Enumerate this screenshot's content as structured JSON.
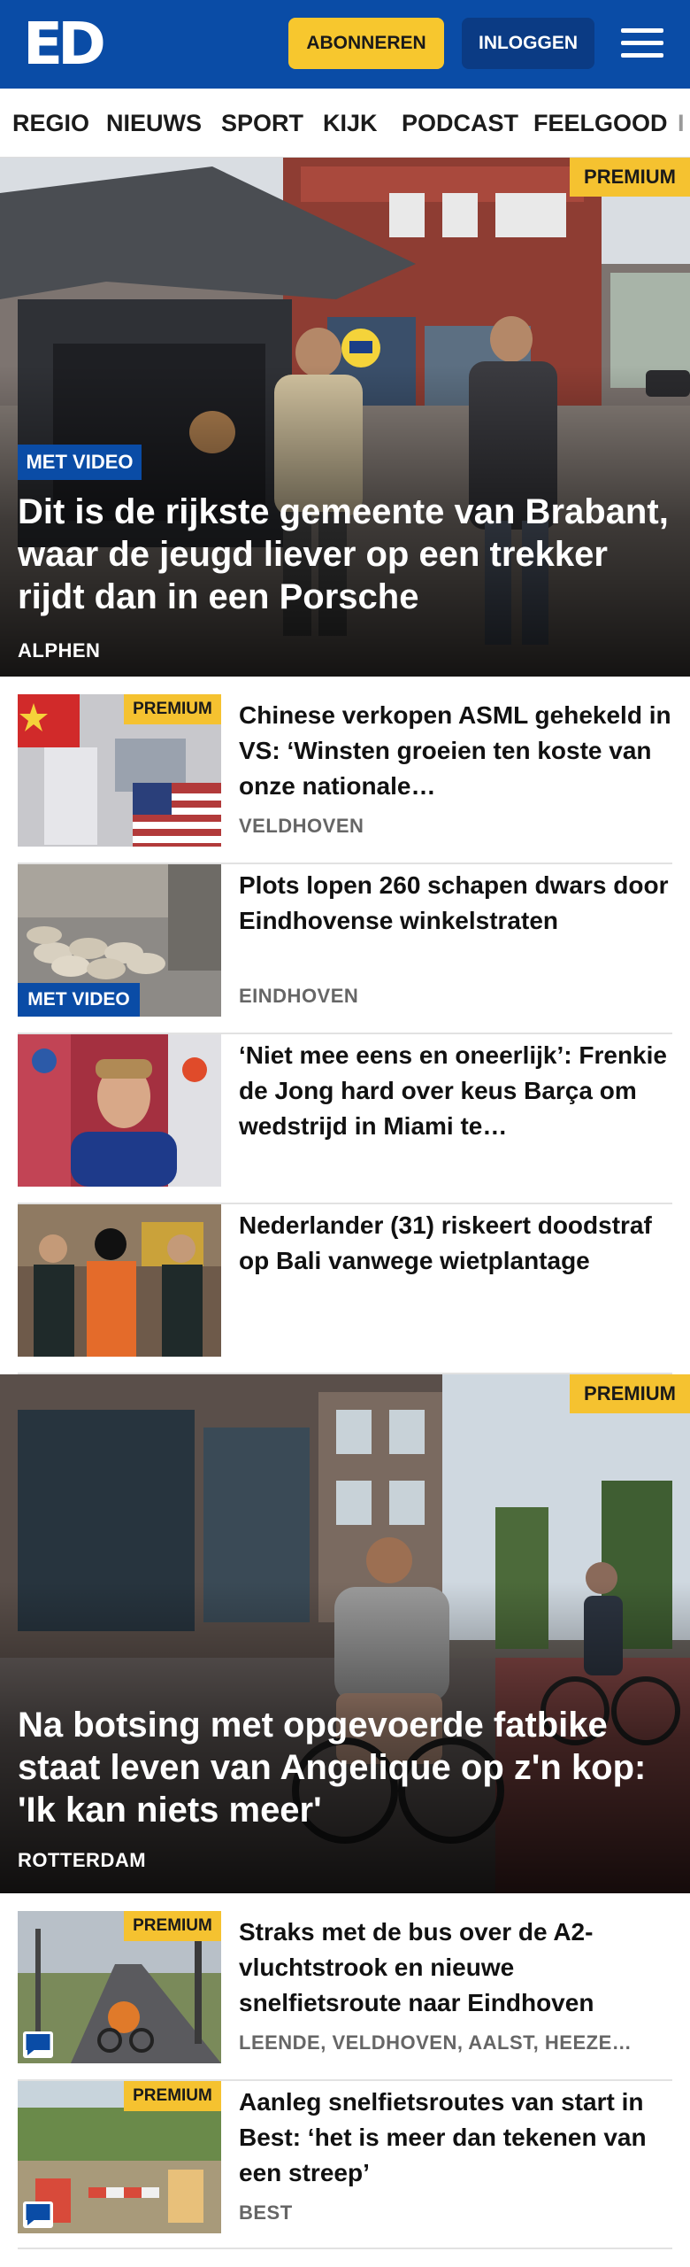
{
  "header": {
    "logo": "ED",
    "subscribe_label": "ABONNEREN",
    "login_label": "INLOGGEN",
    "menu_icon": "hamburger-menu-icon"
  },
  "nav": {
    "items": [
      "REGIO",
      "NIEUWS",
      "SPORT",
      "KIJK",
      "PODCAST",
      "FEELGOOD",
      "I"
    ]
  },
  "colors": {
    "brand_blue": "#0a4ca6",
    "premium_yellow": "#f5c230",
    "subscribe_yellow": "#f7c72e",
    "login_blue": "#0b3b84"
  },
  "hero1": {
    "premium": "PREMIUM",
    "video": "MET VIDEO",
    "title": "Dit is de rijkste gemeente van Brabant, waar de jeugd liever op een trekker rijdt dan in een Porsche",
    "location": "ALPHEN"
  },
  "articles": [
    {
      "premium": "PREMIUM",
      "title": "Chinese verkopen ASML gehekeld in VS: ‘Winsten groeien ten koste van onze nationale…",
      "location": "VELDHOVEN"
    },
    {
      "video": "MET VIDEO",
      "title": "Plots lopen 260 schapen dwars door Eindhovense winkelstraten",
      "location": "EINDHOVEN"
    },
    {
      "title": "‘Niet mee eens en oneerlijk’: Frenkie de Jong hard over keus Barça om wedstrijd in Miami te…",
      "location": ""
    },
    {
      "title": "Nederlander (31) riskeert doodstraf op Bali vanwege wietplantage",
      "location": ""
    }
  ],
  "hero2": {
    "premium": "PREMIUM",
    "title": "Na botsing met opgevoerde fatbike staat leven van Angelique op z'n kop: 'Ik kan niets meer'",
    "location": "ROTTERDAM"
  },
  "articles2": [
    {
      "premium": "PREMIUM",
      "title": "Straks met de bus over de A2-vluchtstrook en nieuwe snelfietsroute naar Eindhoven",
      "location": "LEENDE, VELDHOVEN, AALST, HEEZE…",
      "comment_icon": "comment-icon"
    },
    {
      "premium": "PREMIUM",
      "title": "Aanleg snelfietsroutes van start in Best: ‘het is meer dan tekenen van een streep’",
      "location": "BEST",
      "comment_icon": "comment-icon"
    }
  ]
}
